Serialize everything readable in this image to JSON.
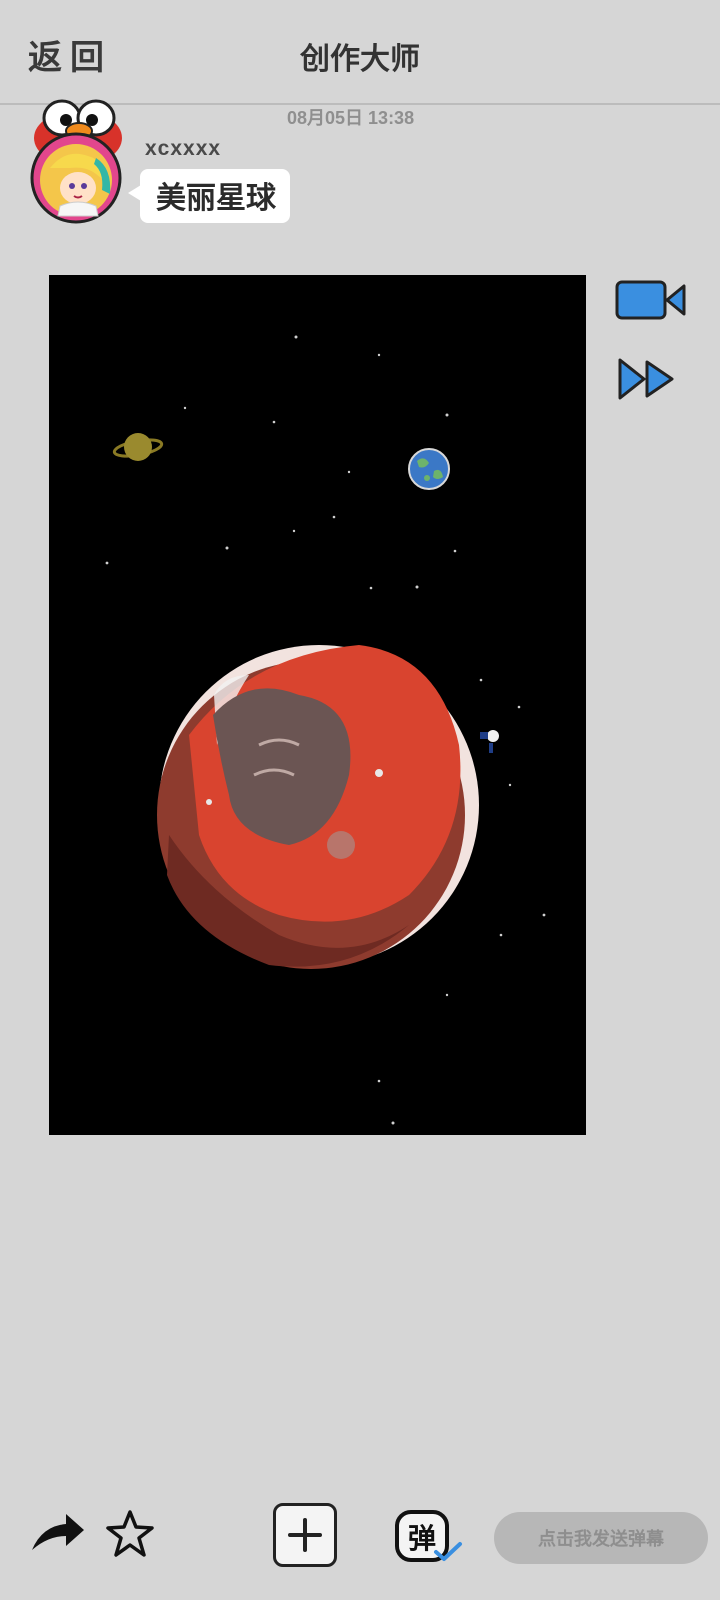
{
  "header": {
    "back_label": "返回",
    "title": "创作大师"
  },
  "post": {
    "timestamp": "08月05日  13:38",
    "username": "xcxxxx",
    "caption": "美丽星球"
  },
  "side_controls": {
    "video_icon": "video-camera-icon",
    "fast_forward_icon": "fast-forward-icon"
  },
  "toolbar": {
    "share_icon": "share-arrow-icon",
    "favorite_icon": "star-icon",
    "add_icon": "plus-icon",
    "danmaku_toggle_label": "弹",
    "danmaku_placeholder": "点击我发送弹幕"
  },
  "colors": {
    "background": "#d6d6d6",
    "accent_blue": "#3a8fe0",
    "planet_red": "#d9442f"
  }
}
